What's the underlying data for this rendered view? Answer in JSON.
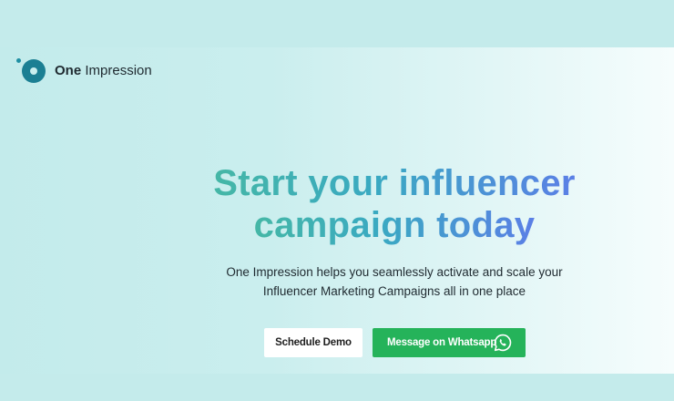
{
  "brand": {
    "name_bold": "One",
    "name_regular": " Impression"
  },
  "hero": {
    "headline_line1": "Start your influencer",
    "headline_line2": "campaign today",
    "subtitle_line1": "One Impression helps you seamlessly activate and scale your",
    "subtitle_line2": "Influencer Marketing Campaigns all in one place"
  },
  "actions": {
    "schedule_demo": "Schedule Demo",
    "message_whatsapp": "Message on Whatsapp"
  },
  "icons": {
    "logo": "one-impression-logo-icon",
    "whatsapp": "whatsapp-icon"
  },
  "colors": {
    "background": "#c6ecec",
    "brand_dark": "#1b7f93",
    "whatsapp_green": "#25b35a",
    "headline_gradient_start": "#45b7a6",
    "headline_gradient_end": "#5b7fe6"
  }
}
